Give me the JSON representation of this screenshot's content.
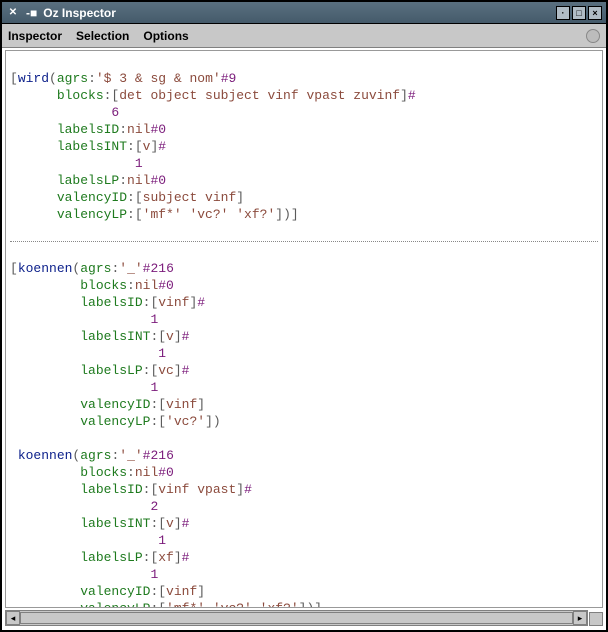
{
  "window": {
    "title": "Oz Inspector"
  },
  "menu": {
    "inspector": "Inspector",
    "selection": "Selection",
    "options": "Options"
  },
  "tree": {
    "wird": {
      "name": "wird",
      "agrs_label": "agrs",
      "agrs_value": "'$ 3 & sg & nom'",
      "agrs_suffix": "#9",
      "blocks_label": "blocks",
      "blocks_value": "det object subject vinf vpast zuvinf",
      "blocks_suffix": "#",
      "blocks_count": "6",
      "labelsID_label": "labelsID",
      "labelsID_value": "nil",
      "labelsID_suffix": "#0",
      "labelsINT_label": "labelsINT",
      "labelsINT_value": "v",
      "labelsINT_suffix": "#",
      "labelsINT_count": "1",
      "labelsLP_label": "labelsLP",
      "labelsLP_value": "nil",
      "labelsLP_suffix": "#0",
      "valencyID_label": "valencyID",
      "valencyID_value": "subject vinf",
      "valencyLP_label": "valencyLP",
      "valencyLP_value": "'mf*' 'vc?' 'xf?'"
    },
    "koennen1": {
      "name": "koennen",
      "agrs_label": "agrs",
      "agrs_value": "'_'",
      "agrs_suffix": "#216",
      "blocks_label": "blocks",
      "blocks_value": "nil",
      "blocks_suffix": "#0",
      "labelsID_label": "labelsID",
      "labelsID_value": "vinf",
      "labelsID_suffix": "#",
      "labelsID_count": "1",
      "labelsINT_label": "labelsINT",
      "labelsINT_value": "v",
      "labelsINT_suffix": "#",
      "labelsINT_count": "1",
      "labelsLP_label": "labelsLP",
      "labelsLP_value": "vc",
      "labelsLP_suffix": "#",
      "labelsLP_count": "1",
      "valencyID_label": "valencyID",
      "valencyID_value": "vinf",
      "valencyLP_label": "valencyLP",
      "valencyLP_value": "'vc?'"
    },
    "koennen2": {
      "name": "koennen",
      "agrs_label": "agrs",
      "agrs_value": "'_'",
      "agrs_suffix": "#216",
      "blocks_label": "blocks",
      "blocks_value": "nil",
      "blocks_suffix": "#0",
      "labelsID_label": "labelsID",
      "labelsID_value": "vinf vpast",
      "labelsID_suffix": "#",
      "labelsID_count": "2",
      "labelsINT_label": "labelsINT",
      "labelsINT_value": "v",
      "labelsINT_suffix": "#",
      "labelsINT_count": "1",
      "labelsLP_label": "labelsLP",
      "labelsLP_value": "xf",
      "labelsLP_suffix": "#",
      "labelsLP_count": "1",
      "valencyID_label": "valencyID",
      "valencyID_value": "vinf",
      "valencyLP_label": "valencyLP",
      "valencyLP_value": "'mf*' 'vc?' 'xf?'"
    }
  }
}
